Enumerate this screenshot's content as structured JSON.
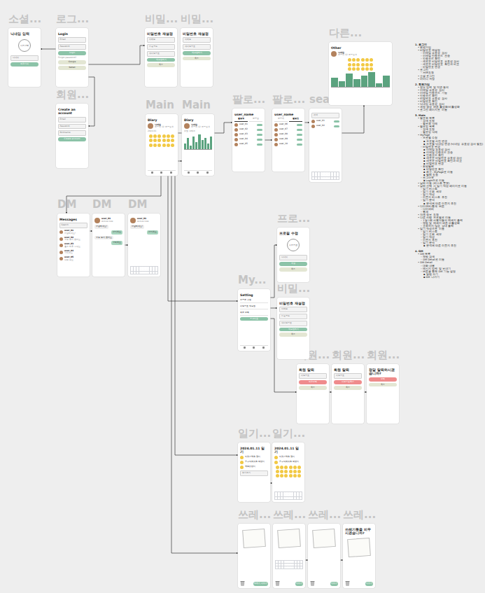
{
  "frames": [
    {
      "label": "소셜...",
      "items": [
        {
          "kind": "heading",
          "text": "닉네임 입력"
        },
        {
          "kind": "avatar-big",
          "text": "사진 선택"
        },
        {
          "kind": "field",
          "text": "닉네임"
        },
        {
          "kind": "button",
          "text": "회원가입"
        }
      ]
    },
    {
      "label": "로그...",
      "items": [
        {
          "kind": "heading",
          "text": "Login"
        },
        {
          "kind": "field",
          "text": "Email"
        },
        {
          "kind": "field",
          "text": "Password"
        },
        {
          "kind": "button",
          "text": "Login"
        },
        {
          "kind": "note",
          "text": "Forgot password?"
        },
        {
          "kind": "button-light",
          "text": "Google"
        },
        {
          "kind": "button-light",
          "text": "Kakao"
        }
      ]
    },
    {
      "label": "비밀...",
      "items": [
        {
          "kind": "heading",
          "text": "비밀번호 재설정"
        },
        {
          "kind": "field",
          "text": "이메일"
        },
        {
          "kind": "field",
          "text": "인증코드"
        },
        {
          "kind": "field",
          "text": "새 비밀번호"
        },
        {
          "kind": "button",
          "text": "재설정하기"
        },
        {
          "kind": "button-light",
          "text": "취소"
        }
      ]
    },
    {
      "label": "비밀...",
      "items": [
        {
          "kind": "heading",
          "text": "비밀번호 재설정"
        },
        {
          "kind": "field",
          "text": "이메일"
        },
        {
          "kind": "field",
          "text": "새 비밀번호"
        },
        {
          "kind": "button",
          "text": "재설정하기"
        },
        {
          "kind": "button-light",
          "text": "취소"
        }
      ]
    },
    {
      "label": "회원...",
      "items": [
        {
          "kind": "heading",
          "text": "Create an account"
        },
        {
          "kind": "field",
          "text": "Email"
        },
        {
          "kind": "field",
          "text": "Password"
        },
        {
          "kind": "field",
          "text": "Nickname"
        },
        {
          "kind": "button",
          "text": "Create account"
        }
      ]
    },
    {
      "label": "Main",
      "items": [
        {
          "kind": "heading",
          "text": "Diary"
        },
        {
          "kind": "profile",
          "text": "닉네임",
          "sub": "팔로워 12 팔로잉 8"
        },
        {
          "kind": "note",
          "text": "2024.01"
        },
        {
          "kind": "emoji-grid"
        },
        {
          "kind": "nav"
        }
      ]
    },
    {
      "label": "Main",
      "items": [
        {
          "kind": "heading",
          "text": "Diary"
        },
        {
          "kind": "profile",
          "text": "닉네임",
          "sub": "팔로워 12 팔로잉 8"
        },
        {
          "kind": "note",
          "text": "감정 그래프"
        },
        {
          "kind": "chart",
          "values": [
            3,
            6,
            2,
            7,
            4,
            8,
            5,
            6,
            3,
            7
          ]
        },
        {
          "kind": "nav"
        }
      ]
    },
    {
      "label": "팔로...",
      "items": [
        {
          "kind": "heading",
          "text": "user_name"
        },
        {
          "kind": "tabs",
          "tabs": [
            {
              "text": "팔로워",
              "selected": true
            },
            {
              "text": "팔로잉",
              "selected": false
            }
          ]
        },
        {
          "kind": "row",
          "text": "user_01"
        },
        {
          "kind": "row",
          "text": "user_02"
        },
        {
          "kind": "row",
          "text": "user_03"
        },
        {
          "kind": "row",
          "text": "user_04"
        },
        {
          "kind": "row",
          "text": "user_05"
        }
      ]
    },
    {
      "label": "팔로...",
      "items": [
        {
          "kind": "heading",
          "text": "user_name"
        },
        {
          "kind": "tabs",
          "tabs": [
            {
              "text": "팔로워",
              "selected": false
            },
            {
              "text": "팔로잉",
              "selected": true
            }
          ]
        },
        {
          "kind": "row",
          "text": "user_06"
        },
        {
          "kind": "row",
          "text": "user_07"
        },
        {
          "kind": "row",
          "text": "user_08"
        },
        {
          "kind": "row",
          "text": "user_09"
        },
        {
          "kind": "row",
          "text": "user_10"
        }
      ]
    },
    {
      "label": "sear...",
      "items": [
        {
          "kind": "field",
          "text": "검색"
        },
        {
          "kind": "row",
          "text": "user_01"
        },
        {
          "kind": "row",
          "text": "user_02"
        },
        {
          "kind": "keyboard"
        }
      ]
    },
    {
      "label": "다른...",
      "items": [
        {
          "kind": "heading",
          "text": "Other"
        },
        {
          "kind": "profile",
          "text": "닉네임",
          "sub": "팔로워 12 팔로잉 8"
        },
        {
          "kind": "emoji-grid"
        },
        {
          "kind": "chart",
          "values": [
            5,
            3,
            7,
            4,
            6,
            8,
            2,
            6
          ]
        }
      ]
    },
    {
      "label": "DM",
      "items": [
        {
          "kind": "heading",
          "text": "Messages"
        },
        {
          "kind": "field",
          "text": "Search"
        },
        {
          "kind": "chat",
          "text": "user_01",
          "sub": "안녕하세요!"
        },
        {
          "kind": "chat",
          "text": "user_02",
          "sub": "오늘 일기 봤어요"
        },
        {
          "kind": "chat",
          "text": "user_03",
          "sub": "좋은 하루 보내요"
        },
        {
          "kind": "chat",
          "text": "user_04",
          "sub": "고마워요"
        },
        {
          "kind": "chat",
          "text": "user_05",
          "sub": "내일 봐요"
        }
      ]
    },
    {
      "label": "DM",
      "items": [
        {
          "kind": "profile",
          "text": "user_01",
          "sub": "Active now"
        },
        {
          "kind": "bubble",
          "text": "안녕하세요!",
          "mine": false
        },
        {
          "kind": "bubble",
          "text": "반가워요",
          "mine": true
        },
        {
          "kind": "bubble",
          "text": "오늘 일기 봤어요",
          "mine": false
        },
        {
          "kind": "bubble",
          "text": "고마워요",
          "mine": true
        }
      ]
    },
    {
      "label": "DM",
      "items": [
        {
          "kind": "profile",
          "text": "user_01",
          "sub": "Active now"
        },
        {
          "kind": "bubble",
          "text": "안녕하세요!",
          "mine": false
        },
        {
          "kind": "bubble",
          "text": "반가워요",
          "mine": true
        },
        {
          "kind": "keyboard"
        }
      ]
    },
    {
      "label": "프로...",
      "items": [
        {
          "kind": "heading",
          "text": "프로필 수정"
        },
        {
          "kind": "avatar-big",
          "text": "사진 변경"
        },
        {
          "kind": "field",
          "text": "닉네임"
        },
        {
          "kind": "button",
          "text": "저장"
        },
        {
          "kind": "button-light",
          "text": "취소"
        }
      ]
    },
    {
      "label": "My...",
      "items": [
        {
          "kind": "heading",
          "text": "Setting"
        },
        {
          "kind": "menu",
          "text": "프로필 수정"
        },
        {
          "kind": "menu",
          "text": "비밀번호 재설정"
        },
        {
          "kind": "menu",
          "text": "회원 탈퇴"
        },
        {
          "kind": "button",
          "text": "로그아웃"
        },
        {
          "kind": "nav"
        }
      ]
    },
    {
      "label": "비밀...",
      "items": [
        {
          "kind": "heading",
          "text": "비밀번호 재설정"
        },
        {
          "kind": "field",
          "text": "이메일"
        },
        {
          "kind": "field",
          "text": "인증코드"
        },
        {
          "kind": "field",
          "text": "새 비밀번호"
        },
        {
          "kind": "button",
          "text": "재설정하기"
        },
        {
          "kind": "button-light",
          "text": "취소"
        }
      ]
    },
    {
      "label": "회원...",
      "items": [
        {
          "kind": "heading",
          "text": "회원 탈퇴"
        },
        {
          "kind": "field",
          "text": "비밀번호"
        },
        {
          "kind": "button-red",
          "text": "회원 탈퇴"
        },
        {
          "kind": "button-light",
          "text": "취소"
        }
      ]
    },
    {
      "label": "회원...",
      "items": [
        {
          "kind": "heading",
          "text": "회원 탈퇴"
        },
        {
          "kind": "field",
          "text": "비밀번호"
        },
        {
          "kind": "button-red",
          "text": "비밀번호 확인"
        },
        {
          "kind": "button-light",
          "text": "취소"
        }
      ]
    },
    {
      "label": "회원...",
      "items": [
        {
          "kind": "heading",
          "text": "정말 탈퇴하시겠습니까?"
        },
        {
          "kind": "button-red",
          "text": "탈퇴"
        },
        {
          "kind": "button-light",
          "text": "취소"
        }
      ]
    },
    {
      "label": "일기...",
      "items": [
        {
          "kind": "heading",
          "text": "2024.01.11 일기"
        },
        {
          "kind": "entry",
          "text": "아침 산책을 했다"
        },
        {
          "kind": "entry",
          "text": "친구와 점심을 먹었다"
        },
        {
          "kind": "entry",
          "text": "책을 읽었다"
        },
        {
          "kind": "field",
          "text": "일기 쓰기"
        }
      ]
    },
    {
      "label": "일기...",
      "items": [
        {
          "kind": "heading",
          "text": "2024.01.11 일기"
        },
        {
          "kind": "entry",
          "text": "아침 산책을 했다"
        },
        {
          "kind": "entry",
          "text": "친구와 점심을 먹었다"
        },
        {
          "kind": "emoji-grid"
        },
        {
          "kind": "keyboard"
        }
      ]
    },
    {
      "label": "쓰레...",
      "items": [
        {
          "kind": "paper"
        },
        {
          "kind": "trash",
          "text": "쓰레기 버리기"
        }
      ]
    },
    {
      "label": "쓰레...",
      "items": [
        {
          "kind": "paper"
        },
        {
          "kind": "keyboard"
        },
        {
          "kind": "trash",
          "text": "버리기"
        }
      ]
    },
    {
      "label": "쓰레...",
      "items": [
        {
          "kind": "paper"
        },
        {
          "kind": "trash",
          "text": "버리기"
        }
      ]
    },
    {
      "label": "쓰레...",
      "items": [
        {
          "kind": "heading",
          "text": "쓰레기통을 비우시겠습니까?"
        },
        {
          "kind": "paper"
        },
        {
          "kind": "trash",
          "text": "비우기"
        }
      ]
    }
  ],
  "notes": [
    {
      "text": "1. 로그인",
      "children": [
        {
          "text": "• 회원가입"
        },
        {
          "text": "• 비밀번호 재설정",
          "children": [
            {
              "text": "◦ 이메일 유효성 검사"
            },
            {
              "text": "◦ 이메일 인증코드 전송"
            },
            {
              "text": "◦ 인증코드 확인"
            },
            {
              "text": "◦ 새로운 비밀번호 유효성 검사"
            },
            {
              "text": "◦ 새로운 비밀번호 확인과 비교"
            },
            {
              "text": "◦ 비밀번호 변경"
            }
          ]
        },
        {
          "text": "• 로그인",
          "children": [
            {
              "text": "◦ 서버요청"
            }
          ]
        },
        {
          "text": "• 소셜 로그인"
        },
        {
          "text": "• 아이디 저장"
        }
      ]
    },
    {
      "text": "2. 회원가입",
      "children": [
        {
          "text": "• 정보 입력 및 약관 동의"
        },
        {
          "text": "• 이메일 유효성 검사"
        },
        {
          "text": "• 이메일 인증코드 기능"
        },
        {
          "text": "• 인증코드 확인"
        },
        {
          "text": "• 비밀번호 유효성 검사"
        },
        {
          "text": "• 비밀번호 확인"
        },
        {
          "text": "• 닉네임 유효성 검사"
        },
        {
          "text": "• 계정 생성 버튼 활성화/비활성화"
        },
        {
          "text": "• 로그인 페이지로 이동"
        }
      ]
    },
    {
      "text": "3. Main",
      "children": [
        {
          "text": "• 팔로워 목록",
          "children": [
            {
              "text": "◦ 검색 요청"
            },
            {
              "text": "◦ 팔로워 삭제"
            }
          ]
        },
        {
          "text": "• 팔로잉 목록",
          "children": [
            {
              "text": "◦ 검색 요청"
            },
            {
              "text": "◦ 팔로잉 삭제"
            }
          ]
        },
        {
          "text": "• MyPage",
          "children": [
            {
              "text": "◦ 프로필 수정",
              "children": [
                {
                  "text": "▪ 프로필 사진 변경"
                },
                {
                  "text": "▪ 프로필 닉네임 변경 (닉네임 유효성 검사 필요)"
                }
              ]
            },
            {
              "text": "◦ 비밀번호 변경",
              "children": [
                {
                  "text": "▪ 이메일 유효성 검사"
                },
                {
                  "text": "▪ 이메일 인증코드 전송"
                },
                {
                  "text": "▪ 인증코드 확인"
                },
                {
                  "text": "▪ 새로운 비밀번호 유효성 검사"
                },
                {
                  "text": "▪ 새로운 비밀번호 확인과 비교"
                },
                {
                  "text": "▪ 비밀번호 변경"
                }
              ]
            },
            {
              "text": "◦ 회원탈퇴",
              "children": [
                {
                  "text": "▪ 비밀번호 확인"
                },
                {
                  "text": "▪ 취소 : MyPage로 이동"
                },
                {
                  "text": "▪ 탈퇴 요청"
                }
              ]
            },
            {
              "text": "◦ 로그아웃",
              "children": [
                {
                  "text": "▪ Login으로 이동"
                }
              ]
            }
          ]
        },
        {
          "text": "• 날짜 이동 (리스트 포맷)"
        },
        {
          "text": "• 날짜 선택 시 일기 작성 페이지로 이동",
          "children": [
            {
              "text": "◦ 일기 리스트"
            },
            {
              "text": "◦ 일기 조회 세부"
            },
            {
              "text": "◦ 일기 작성"
            },
            {
              "text": "◦ 이모지 리스트 추천"
            },
            {
              "text": "◦ 일기 분석",
              "children": [
                {
                  "text": "▪ 분석에 따른 이모지 추천"
                }
              ]
            }
          ]
        },
        {
          "text": "• 다이어리/통계 버튼",
          "children": [
            {
              "text": "◦ 다이어리"
            },
            {
              "text": "◦ 통계"
            }
          ]
        },
        {
          "text": "• 자세 정보 요청"
        },
        {
          "text": "• 다른 사람 프로필로 이동",
          "children": [
            {
              "text": "◦ 1달 1회 사용자들의 메세지 출력"
            },
            {
              "text": "◦ 채팅 및 메세지 버튼 비활성화"
            },
            {
              "text": "◦ 교류하지 않은 상대 출력"
            }
          ]
        },
        {
          "text": "• 일기 작성으로 이동",
          "children": [
            {
              "text": "◦ 일기 리스트"
            },
            {
              "text": "◦ 일기 조회 세부"
            },
            {
              "text": "◦ 일기 작성"
            },
            {
              "text": "◦ 이모지 추천"
            },
            {
              "text": "◦ 일기 분석",
              "children": [
                {
                  "text": "▪ 분석에 따른 이모지 추천"
                }
              ]
            }
          ]
        }
      ]
    },
    {
      "text": "4. DM",
      "children": [
        {
          "text": "• DM 목록",
          "children": [
            {
              "text": "◦ 채팅 검색"
            },
            {
              "text": "◦ DM Detail로 이동"
            }
          ]
        },
        {
          "text": "• DM Detail",
          "children": [
            {
              "text": "◦ 대화 내용"
            },
            {
              "text": "◦ 메시지 입력 및 보내기"
            },
            {
              "text": "◦ 버튼을 통해 DM 기능 설정",
              "children": [
                {
                  "text": "▪ 알림 끄기"
                },
                {
                  "text": "▪ DM 나가기"
                }
              ]
            }
          ]
        }
      ]
    }
  ]
}
